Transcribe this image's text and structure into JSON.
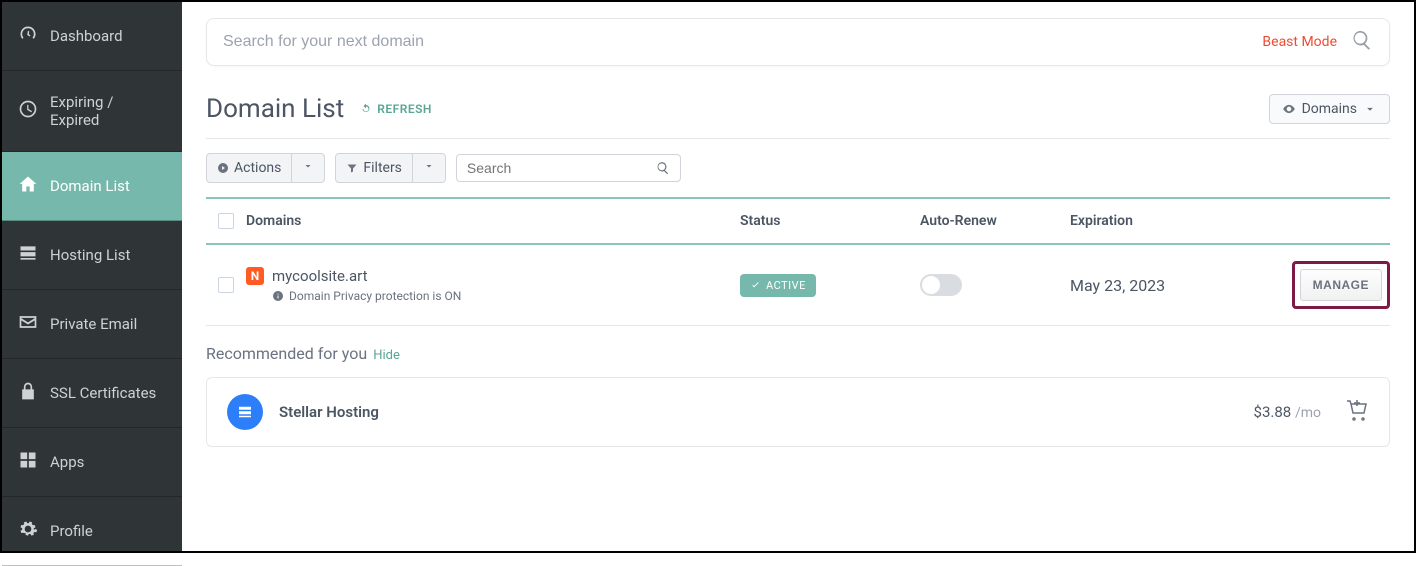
{
  "sidebar": {
    "items": [
      {
        "label": "Dashboard"
      },
      {
        "label": "Expiring / Expired"
      },
      {
        "label": "Domain List"
      },
      {
        "label": "Hosting List"
      },
      {
        "label": "Private Email"
      },
      {
        "label": "SSL Certificates"
      },
      {
        "label": "Apps"
      },
      {
        "label": "Profile"
      }
    ]
  },
  "search": {
    "placeholder": "Search for your next domain",
    "beast_mode": "Beast Mode"
  },
  "page": {
    "title": "Domain List",
    "refresh": "REFRESH",
    "view_label": "Domains"
  },
  "toolbar": {
    "actions": "Actions",
    "filters": "Filters",
    "table_search_placeholder": "Search"
  },
  "table": {
    "headers": {
      "domain": "Domains",
      "status": "Status",
      "auto": "Auto-Renew",
      "exp": "Expiration"
    },
    "row": {
      "domain": "mycoolsite.art",
      "privacy": "Domain Privacy protection is ON",
      "status": "ACTIVE",
      "expiration": "May 23, 2023",
      "manage": "MANAGE"
    }
  },
  "reco": {
    "heading": "Recommended for you",
    "hide": "Hide",
    "item": {
      "title": "Stellar Hosting",
      "price": "$3.88",
      "period": "/mo"
    }
  }
}
